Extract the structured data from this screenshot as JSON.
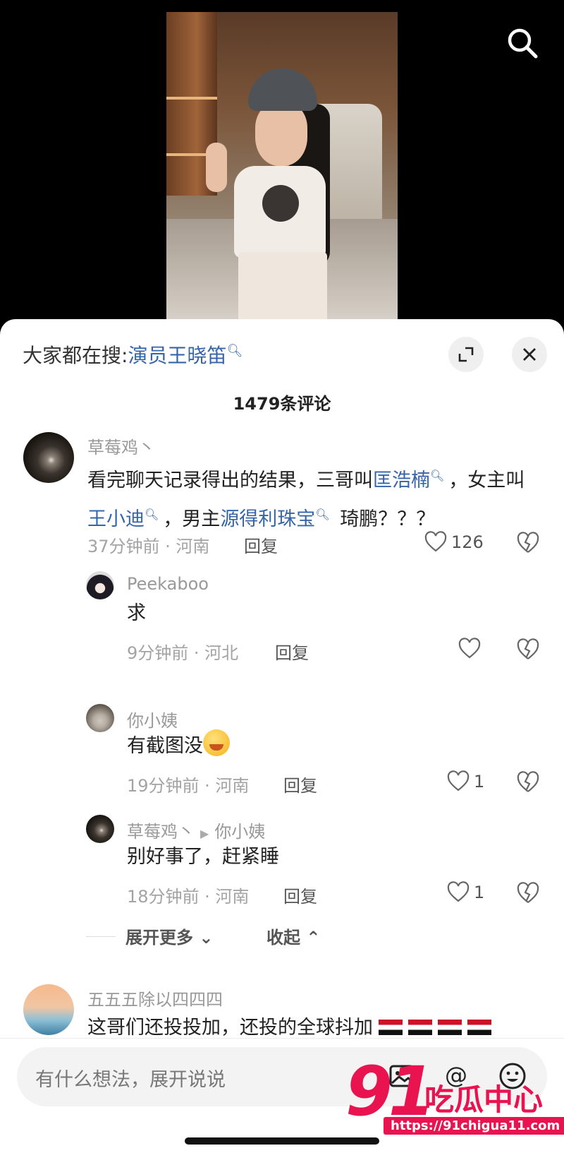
{
  "header": {
    "search_icon": "search-icon"
  },
  "sheet": {
    "trending_prefix": "大家都在搜:",
    "trending_term": "演员王晓笛",
    "comment_count": "1479条评论",
    "expand_icon": "expand-icon",
    "close_icon": "close-icon"
  },
  "comments": [
    {
      "user": "草莓鸡丶",
      "text_parts": [
        "看完聊天记录得出的结果，三哥叫",
        "匡浩楠",
        "，女主叫",
        "王小迪",
        "，男主",
        "源得利珠宝",
        " 琦鹏？？？"
      ],
      "time_loc": "37分钟前 · 河南",
      "reply_label": "回复",
      "likes": "126"
    }
  ],
  "replies": [
    {
      "user": "Peekaboo",
      "text": "求",
      "time_loc": "9分钟前 · 河北",
      "reply_label": "回复",
      "likes": ""
    },
    {
      "user": "你小姨",
      "text": "有截图没",
      "time_loc": "19分钟前 · 河南",
      "reply_label": "回复",
      "likes": "1"
    },
    {
      "user": "草莓鸡丶",
      "reply_to": "你小姨",
      "text": "别好事了，赶紧睡",
      "time_loc": "18分钟前 · 河南",
      "reply_label": "回复",
      "likes": "1"
    }
  ],
  "thread_controls": {
    "more_label": "展开更多",
    "collapse_label": "收起"
  },
  "next_comment": {
    "user": "五五五除以四四四",
    "text": "这哥们还投投加，还投的全球抖加"
  },
  "input": {
    "placeholder": "有什么想法，展开说说",
    "icons": [
      "image-icon",
      "at-icon",
      "emoji-icon"
    ]
  },
  "watermark": {
    "logo": "91",
    "name": "吃瓜中心",
    "url": "https://91chigua11.com"
  },
  "colors": {
    "link": "#3565a8",
    "watermark": "#e8134f"
  }
}
